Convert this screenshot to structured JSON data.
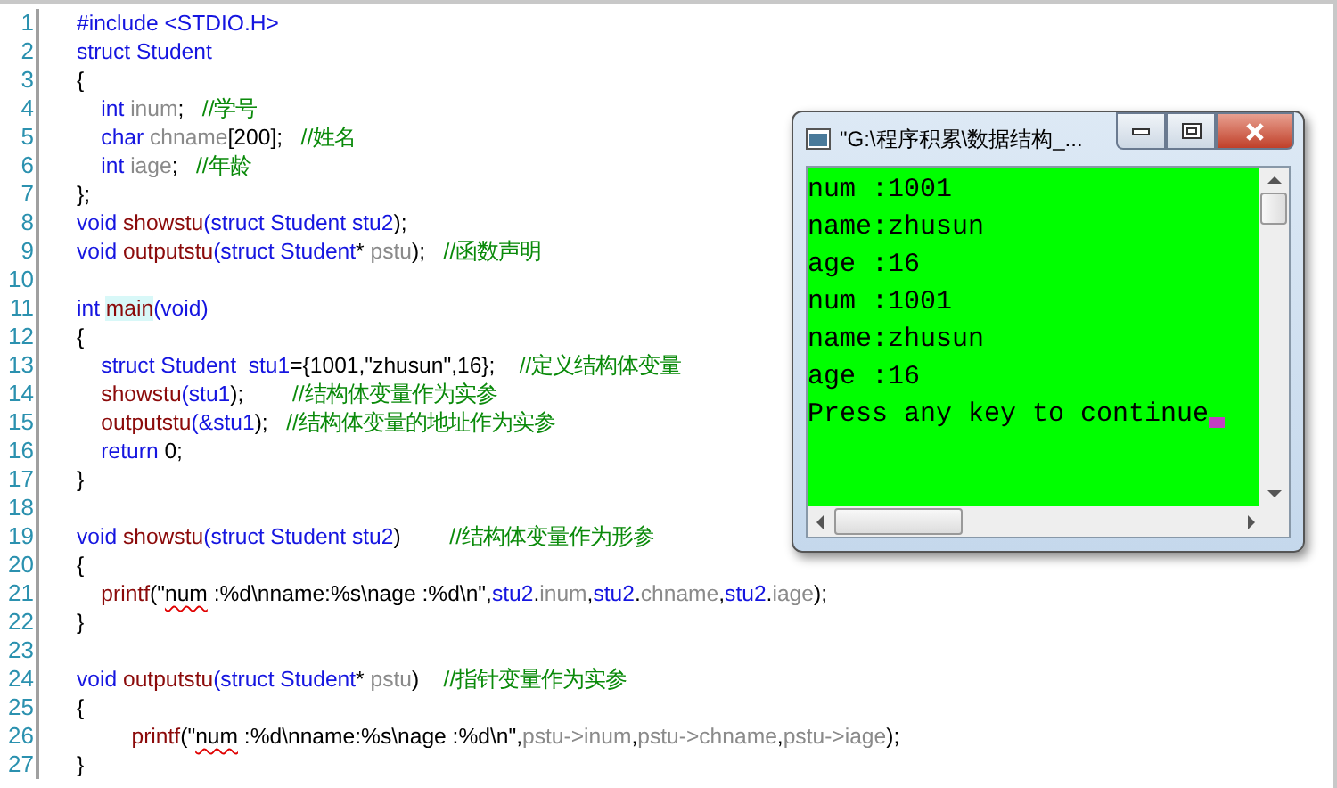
{
  "editor": {
    "lines": [
      {
        "number": "1",
        "tokens": [
          {
            "kind": "keyword",
            "text": "#include <STDIO.H>"
          }
        ]
      },
      {
        "number": "2",
        "tokens": [
          {
            "kind": "keyword",
            "text": "struct Student"
          }
        ]
      },
      {
        "number": "3",
        "tokens": [
          {
            "kind": "plain",
            "text": "{"
          }
        ]
      },
      {
        "number": "4",
        "tokens": [
          {
            "kind": "keyword",
            "text": "    int"
          },
          {
            "kind": "variable",
            "text": " inum"
          },
          {
            "kind": "plain",
            "text": ";   "
          },
          {
            "kind": "comment",
            "text": "//学号"
          }
        ]
      },
      {
        "number": "5",
        "tokens": [
          {
            "kind": "keyword",
            "text": "    char"
          },
          {
            "kind": "variable",
            "text": " chname"
          },
          {
            "kind": "plain",
            "text": "[200];   "
          },
          {
            "kind": "comment",
            "text": "//姓名"
          }
        ]
      },
      {
        "number": "6",
        "tokens": [
          {
            "kind": "keyword",
            "text": "    int"
          },
          {
            "kind": "variable",
            "text": " iage"
          },
          {
            "kind": "plain",
            "text": ";   "
          },
          {
            "kind": "comment",
            "text": "//年龄"
          }
        ]
      },
      {
        "number": "7",
        "tokens": [
          {
            "kind": "plain",
            "text": "};"
          }
        ]
      },
      {
        "number": "8",
        "tokens": [
          {
            "kind": "keyword",
            "text": "void"
          },
          {
            "kind": "function",
            "text": " showstu"
          },
          {
            "kind": "keyword",
            "text": "(struct Student stu2"
          },
          {
            "kind": "plain",
            "text": ");"
          }
        ]
      },
      {
        "number": "9",
        "tokens": [
          {
            "kind": "keyword",
            "text": "void"
          },
          {
            "kind": "function",
            "text": " outputstu"
          },
          {
            "kind": "keyword",
            "text": "(struct Student"
          },
          {
            "kind": "plain",
            "text": "*"
          },
          {
            "kind": "variable",
            "text": " pstu"
          },
          {
            "kind": "plain",
            "text": ");   "
          },
          {
            "kind": "comment",
            "text": "//函数声明"
          }
        ]
      },
      {
        "number": "10"
      },
      {
        "number": "11",
        "tokens": [
          {
            "kind": "keyword",
            "text": "int "
          },
          {
            "kind": "function",
            "text": "main",
            "highlighted": true
          },
          {
            "kind": "keyword",
            "text": "(void)"
          }
        ]
      },
      {
        "number": "12",
        "tokens": [
          {
            "kind": "plain",
            "text": "{"
          }
        ]
      },
      {
        "number": "13",
        "tokens": [
          {
            "kind": "keyword",
            "text": "    struct Student  stu1"
          },
          {
            "kind": "plain",
            "text": "={1001,\"zhusun\",16};    "
          },
          {
            "kind": "comment",
            "text": "//定义结构体变量"
          }
        ]
      },
      {
        "number": "14",
        "tokens": [
          {
            "kind": "function",
            "text": "    showstu"
          },
          {
            "kind": "keyword",
            "text": "(stu1"
          },
          {
            "kind": "plain",
            "text": ");        "
          },
          {
            "kind": "comment",
            "text": "//结构体变量作为实参"
          }
        ]
      },
      {
        "number": "15",
        "tokens": [
          {
            "kind": "function",
            "text": "    outputstu"
          },
          {
            "kind": "keyword",
            "text": "(&stu1"
          },
          {
            "kind": "plain",
            "text": ");   "
          },
          {
            "kind": "comment",
            "text": "//结构体变量的地址作为实参"
          }
        ]
      },
      {
        "number": "16",
        "tokens": [
          {
            "kind": "keyword",
            "text": "    return"
          },
          {
            "kind": "plain",
            "text": " 0;"
          }
        ]
      },
      {
        "number": "17",
        "tokens": [
          {
            "kind": "plain",
            "text": "}"
          }
        ]
      },
      {
        "number": "18"
      },
      {
        "number": "19",
        "tokens": [
          {
            "kind": "keyword",
            "text": "void"
          },
          {
            "kind": "function",
            "text": " showstu"
          },
          {
            "kind": "keyword",
            "text": "(struct Student stu2"
          },
          {
            "kind": "plain",
            "text": ")        "
          },
          {
            "kind": "comment",
            "text": "//结构体变量作为形参"
          }
        ]
      },
      {
        "number": "20",
        "tokens": [
          {
            "kind": "plain",
            "text": "{"
          }
        ]
      },
      {
        "number": "21",
        "tokens": [
          {
            "kind": "function",
            "text": "    printf"
          },
          {
            "kind": "plain",
            "text": "(\""
          },
          {
            "kind": "plain",
            "text": "num",
            "marked": true
          },
          {
            "kind": "plain",
            "text": " :%d\\nname:%s\\nage :%d\\n\","
          },
          {
            "kind": "keyword",
            "text": "stu2"
          },
          {
            "kind": "plain",
            "text": "."
          },
          {
            "kind": "variable",
            "text": "inum"
          },
          {
            "kind": "plain",
            "text": ","
          },
          {
            "kind": "keyword",
            "text": "stu2"
          },
          {
            "kind": "plain",
            "text": "."
          },
          {
            "kind": "variable",
            "text": "chname"
          },
          {
            "kind": "plain",
            "text": ","
          },
          {
            "kind": "keyword",
            "text": "stu2"
          },
          {
            "kind": "plain",
            "text": "."
          },
          {
            "kind": "variable",
            "text": "iage"
          },
          {
            "kind": "plain",
            "text": ");"
          }
        ]
      },
      {
        "number": "22",
        "tokens": [
          {
            "kind": "plain",
            "text": "}"
          }
        ]
      },
      {
        "number": "23"
      },
      {
        "number": "24",
        "tokens": [
          {
            "kind": "keyword",
            "text": "void"
          },
          {
            "kind": "function",
            "text": " outputstu"
          },
          {
            "kind": "keyword",
            "text": "(struct Student"
          },
          {
            "kind": "plain",
            "text": "*"
          },
          {
            "kind": "variable",
            "text": " pstu"
          },
          {
            "kind": "plain",
            "text": ")    "
          },
          {
            "kind": "comment",
            "text": "//指针变量作为实参"
          }
        ]
      },
      {
        "number": "25",
        "tokens": [
          {
            "kind": "plain",
            "text": "{"
          }
        ]
      },
      {
        "number": "26",
        "tokens": [
          {
            "kind": "function",
            "text": "         printf"
          },
          {
            "kind": "plain",
            "text": "(\""
          },
          {
            "kind": "plain",
            "text": "num",
            "marked": true
          },
          {
            "kind": "plain",
            "text": " :%d\\nname:%s\\nage :%d\\n\","
          },
          {
            "kind": "variable",
            "text": "pstu->inum"
          },
          {
            "kind": "plain",
            "text": ","
          },
          {
            "kind": "variable",
            "text": "pstu->chname"
          },
          {
            "kind": "plain",
            "text": ","
          },
          {
            "kind": "variable",
            "text": "pstu->iage"
          },
          {
            "kind": "plain",
            "text": ");"
          }
        ]
      },
      {
        "number": "27",
        "tokens": [
          {
            "kind": "plain",
            "text": "}"
          }
        ]
      }
    ]
  },
  "console": {
    "title": "\"G:\\程序积累\\数据结构_...",
    "output": [
      "num :1001",
      "name:zhusun",
      "age :16",
      "num :1001",
      "name:zhusun",
      "age :16",
      "Press any key to continue"
    ]
  }
}
